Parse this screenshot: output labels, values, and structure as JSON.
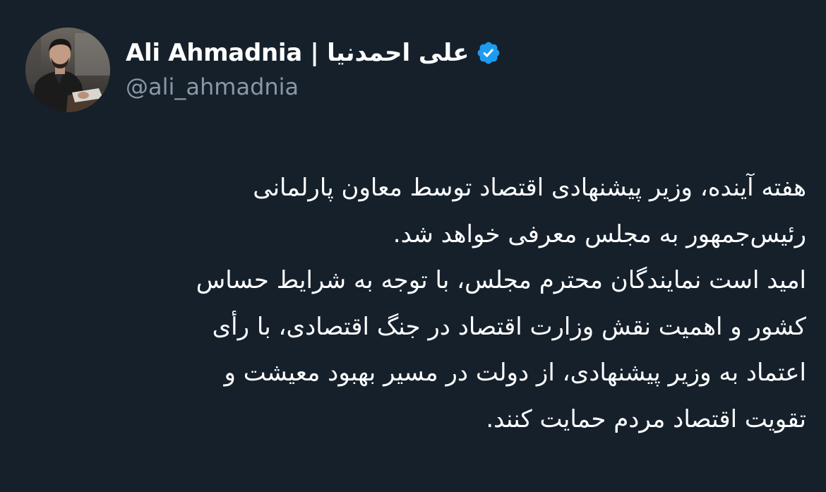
{
  "user": {
    "display_name": "Ali Ahmadnia | علی احمدنیا",
    "handle": "@ali_ahmadnia",
    "verified": true,
    "verified_badge_color": "#1d9bf0"
  },
  "tweet": {
    "lines": [
      "هفته آینده، وزیر پیشنهادی اقتصاد توسط معاون پارلمانی",
      "رئیس‌جمهور به مجلس معرفی خواهد شد.",
      "امید است نمایندگان محترم مجلس، با توجه به شرایط حساس",
      "کشور و اهمیت نقش وزارت اقتصاد در جنگ اقتصادی، با رأی",
      "اعتماد به وزیر پیشنهادی، از دولت در مسیر بهبود معیشت و",
      "تقویت اقتصاد مردم حمایت کنند."
    ]
  },
  "colors": {
    "background": "#15202b",
    "text": "#ffffff",
    "secondary_text": "#8b98a5"
  }
}
